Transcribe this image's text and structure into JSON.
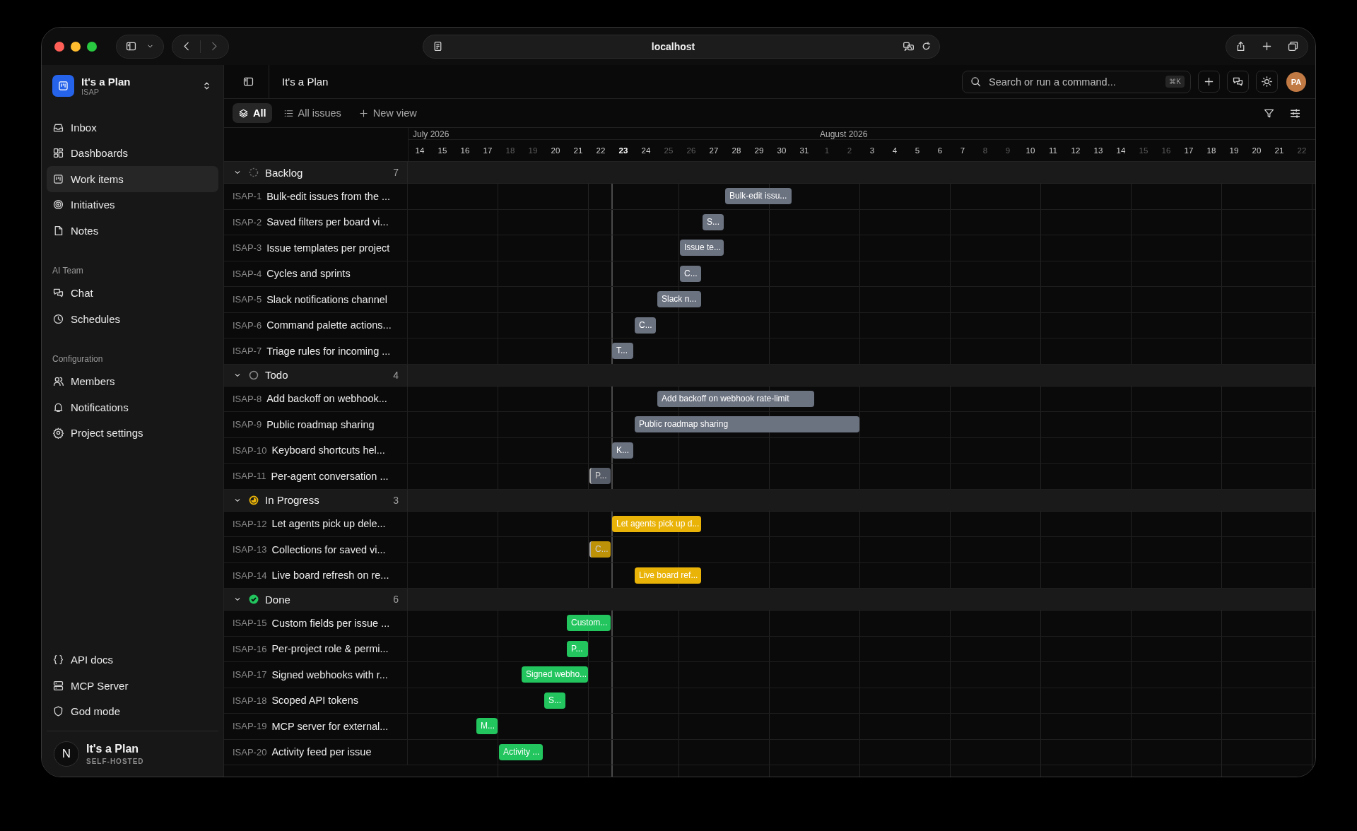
{
  "browser": {
    "url": "localhost"
  },
  "workspace": {
    "name": "It's a Plan",
    "key": "ISAP"
  },
  "nav": [
    {
      "label": "Inbox",
      "selected": false
    },
    {
      "label": "Dashboards",
      "selected": false
    },
    {
      "label": "Work items",
      "selected": true
    },
    {
      "label": "Initiatives",
      "selected": false
    },
    {
      "label": "Notes",
      "selected": false
    }
  ],
  "sections": [
    {
      "title": "AI Team",
      "items": [
        {
          "label": "Chat",
          "selected": false
        },
        {
          "label": "Schedules",
          "selected": false
        }
      ]
    },
    {
      "title": "Configuration",
      "items": [
        {
          "label": "Members",
          "selected": false
        },
        {
          "label": "Notifications",
          "selected": false
        },
        {
          "label": "Project settings",
          "selected": false
        }
      ]
    }
  ],
  "footer_links": [
    {
      "label": "API docs"
    },
    {
      "label": "MCP Server"
    },
    {
      "label": "God mode"
    }
  ],
  "footer": {
    "initial": "N",
    "name": "It's a Plan",
    "edition": "SELF-HOSTED"
  },
  "header": {
    "title": "It's a Plan",
    "search_placeholder": "Search or run a command...",
    "shortcut": "⌘K",
    "avatar": "PA"
  },
  "views": [
    {
      "label": "All",
      "selected": true
    },
    {
      "label": "All issues",
      "selected": false
    },
    {
      "label": "New view",
      "selected": false
    }
  ],
  "timeline": {
    "months": [
      {
        "label": "July 2026",
        "days": [
          {
            "label": "14",
            "weekend": false,
            "today": false
          },
          {
            "label": "15",
            "weekend": false,
            "today": false
          },
          {
            "label": "16",
            "weekend": false,
            "today": false
          },
          {
            "label": "17",
            "weekend": false,
            "today": false
          },
          {
            "label": "18",
            "weekend": true,
            "today": false
          },
          {
            "label": "19",
            "weekend": true,
            "today": false
          },
          {
            "label": "20",
            "weekend": false,
            "today": false
          },
          {
            "label": "21",
            "weekend": false,
            "today": false
          },
          {
            "label": "22",
            "weekend": false,
            "today": false
          },
          {
            "label": "23",
            "weekend": false,
            "today": true
          },
          {
            "label": "24",
            "weekend": false,
            "today": false
          },
          {
            "label": "25",
            "weekend": true,
            "today": false
          },
          {
            "label": "26",
            "weekend": true,
            "today": false
          },
          {
            "label": "27",
            "weekend": false,
            "today": false
          },
          {
            "label": "28",
            "weekend": false,
            "today": false
          },
          {
            "label": "29",
            "weekend": false,
            "today": false
          },
          {
            "label": "30",
            "weekend": false,
            "today": false
          },
          {
            "label": "31",
            "weekend": false,
            "today": false
          }
        ]
      },
      {
        "label": "August 2026",
        "days": [
          {
            "label": "1",
            "weekend": true,
            "today": false
          },
          {
            "label": "2",
            "weekend": true,
            "today": false
          },
          {
            "label": "3",
            "weekend": false,
            "today": false
          },
          {
            "label": "4",
            "weekend": false,
            "today": false
          },
          {
            "label": "5",
            "weekend": false,
            "today": false
          },
          {
            "label": "6",
            "weekend": false,
            "today": false
          },
          {
            "label": "7",
            "weekend": false,
            "today": false
          },
          {
            "label": "8",
            "weekend": true,
            "today": false
          },
          {
            "label": "9",
            "weekend": true,
            "today": false
          },
          {
            "label": "10",
            "weekend": false,
            "today": false
          },
          {
            "label": "11",
            "weekend": false,
            "today": false
          },
          {
            "label": "12",
            "weekend": false,
            "today": false
          },
          {
            "label": "13",
            "weekend": false,
            "today": false
          },
          {
            "label": "14",
            "weekend": false,
            "today": false
          },
          {
            "label": "15",
            "weekend": true,
            "today": false
          },
          {
            "label": "16",
            "weekend": true,
            "today": false
          },
          {
            "label": "17",
            "weekend": false,
            "today": false
          },
          {
            "label": "18",
            "weekend": false,
            "today": false
          },
          {
            "label": "19",
            "weekend": false,
            "today": false
          },
          {
            "label": "20",
            "weekend": false,
            "today": false
          },
          {
            "label": "21",
            "weekend": false,
            "today": false
          },
          {
            "label": "22",
            "weekend": true,
            "today": false
          }
        ]
      }
    ]
  },
  "groups": [
    {
      "name": "Backlog",
      "kind": "backlog",
      "count": "7",
      "expanded": true,
      "items": [
        {
          "id": "ISAP-1",
          "title": "Bulk-edit issues from the ...",
          "bar": {
            "label": "Bulk-edit issu...",
            "muted": false,
            "days": [
              false,
              false,
              false,
              false,
              false,
              false,
              false,
              false,
              false,
              false,
              false,
              false,
              false,
              false,
              true,
              true,
              true,
              false,
              false,
              false,
              false,
              false,
              false,
              false,
              false,
              false,
              false,
              false,
              false,
              false,
              false,
              false,
              false,
              false,
              false,
              false,
              false,
              false,
              false,
              false
            ]
          }
        },
        {
          "id": "ISAP-2",
          "title": "Saved filters per board vi...",
          "bar": {
            "label": "S...",
            "muted": false,
            "days": [
              false,
              false,
              false,
              false,
              false,
              false,
              false,
              false,
              false,
              false,
              false,
              false,
              false,
              true,
              false,
              false,
              false,
              false,
              false,
              false,
              false,
              false,
              false,
              false,
              false,
              false,
              false,
              false,
              false,
              false,
              false,
              false,
              false,
              false,
              false,
              false,
              false,
              false,
              false,
              false
            ]
          }
        },
        {
          "id": "ISAP-3",
          "title": "Issue templates per project",
          "bar": {
            "label": "Issue te...",
            "muted": false,
            "days": [
              false,
              false,
              false,
              false,
              false,
              false,
              false,
              false,
              false,
              false,
              false,
              false,
              true,
              true,
              false,
              false,
              false,
              false,
              false,
              false,
              false,
              false,
              false,
              false,
              false,
              false,
              false,
              false,
              false,
              false,
              false,
              false,
              false,
              false,
              false,
              false,
              false,
              false,
              false,
              false
            ]
          }
        },
        {
          "id": "ISAP-4",
          "title": "Cycles and sprints",
          "bar": {
            "label": "C...",
            "muted": false,
            "days": [
              false,
              false,
              false,
              false,
              false,
              false,
              false,
              false,
              false,
              false,
              false,
              false,
              true,
              false,
              false,
              false,
              false,
              false,
              false,
              false,
              false,
              false,
              false,
              false,
              false,
              false,
              false,
              false,
              false,
              false,
              false,
              false,
              false,
              false,
              false,
              false,
              false,
              false,
              false,
              false
            ]
          }
        },
        {
          "id": "ISAP-5",
          "title": "Slack notifications channel",
          "bar": {
            "label": "Slack n...",
            "muted": false,
            "days": [
              false,
              false,
              false,
              false,
              false,
              false,
              false,
              false,
              false,
              false,
              false,
              true,
              true,
              false,
              false,
              false,
              false,
              false,
              false,
              false,
              false,
              false,
              false,
              false,
              false,
              false,
              false,
              false,
              false,
              false,
              false,
              false,
              false,
              false,
              false,
              false,
              false,
              false,
              false,
              false
            ]
          }
        },
        {
          "id": "ISAP-6",
          "title": "Command palette actions...",
          "bar": {
            "label": "C...",
            "muted": false,
            "days": [
              false,
              false,
              false,
              false,
              false,
              false,
              false,
              false,
              false,
              false,
              true,
              false,
              false,
              false,
              false,
              false,
              false,
              false,
              false,
              false,
              false,
              false,
              false,
              false,
              false,
              false,
              false,
              false,
              false,
              false,
              false,
              false,
              false,
              false,
              false,
              false,
              false,
              false,
              false,
              false
            ]
          }
        },
        {
          "id": "ISAP-7",
          "title": "Triage rules for incoming ...",
          "bar": {
            "label": "T...",
            "muted": false,
            "days": [
              false,
              false,
              false,
              false,
              false,
              false,
              false,
              false,
              false,
              true,
              false,
              false,
              false,
              false,
              false,
              false,
              false,
              false,
              false,
              false,
              false,
              false,
              false,
              false,
              false,
              false,
              false,
              false,
              false,
              false,
              false,
              false,
              false,
              false,
              false,
              false,
              false,
              false,
              false,
              false
            ]
          }
        }
      ]
    },
    {
      "name": "Todo",
      "kind": "todo",
      "count": "4",
      "expanded": true,
      "items": [
        {
          "id": "ISAP-8",
          "title": "Add backoff on webhook...",
          "bar": {
            "label": "Add backoff on webhook rate-limit",
            "muted": false,
            "days": [
              false,
              false,
              false,
              false,
              false,
              false,
              false,
              false,
              false,
              false,
              false,
              true,
              true,
              true,
              true,
              true,
              true,
              true,
              false,
              false,
              false,
              false,
              false,
              false,
              false,
              false,
              false,
              false,
              false,
              false,
              false,
              false,
              false,
              false,
              false,
              false,
              false,
              false,
              false,
              false
            ]
          }
        },
        {
          "id": "ISAP-9",
          "title": "Public roadmap sharing",
          "bar": {
            "label": "Public roadmap sharing",
            "muted": false,
            "days": [
              false,
              false,
              false,
              false,
              false,
              false,
              false,
              false,
              false,
              false,
              true,
              true,
              true,
              true,
              true,
              true,
              true,
              true,
              true,
              true,
              false,
              false,
              false,
              false,
              false,
              false,
              false,
              false,
              false,
              false,
              false,
              false,
              false,
              false,
              false,
              false,
              false,
              false,
              false,
              false
            ]
          }
        },
        {
          "id": "ISAP-10",
          "title": "Keyboard shortcuts hel...",
          "bar": {
            "label": "K...",
            "muted": false,
            "days": [
              false,
              false,
              false,
              false,
              false,
              false,
              false,
              false,
              false,
              true,
              false,
              false,
              false,
              false,
              false,
              false,
              false,
              false,
              false,
              false,
              false,
              false,
              false,
              false,
              false,
              false,
              false,
              false,
              false,
              false,
              false,
              false,
              false,
              false,
              false,
              false,
              false,
              false,
              false,
              false
            ]
          }
        },
        {
          "id": "ISAP-11",
          "title": "Per-agent conversation ...",
          "bar": {
            "label": "P...",
            "muted": true,
            "days": [
              false,
              false,
              false,
              false,
              false,
              false,
              false,
              false,
              true,
              false,
              false,
              false,
              false,
              false,
              false,
              false,
              false,
              false,
              false,
              false,
              false,
              false,
              false,
              false,
              false,
              false,
              false,
              false,
              false,
              false,
              false,
              false,
              false,
              false,
              false,
              false,
              false,
              false,
              false,
              false
            ]
          }
        }
      ]
    },
    {
      "name": "In Progress",
      "kind": "in_progress",
      "count": "3",
      "expanded": true,
      "items": [
        {
          "id": "ISAP-12",
          "title": "Let agents pick up dele...",
          "bar": {
            "label": "Let agents pick up d...",
            "muted": false,
            "days": [
              false,
              false,
              false,
              false,
              false,
              false,
              false,
              false,
              false,
              true,
              true,
              true,
              true,
              false,
              false,
              false,
              false,
              false,
              false,
              false,
              false,
              false,
              false,
              false,
              false,
              false,
              false,
              false,
              false,
              false,
              false,
              false,
              false,
              false,
              false,
              false,
              false,
              false,
              false,
              false
            ]
          }
        },
        {
          "id": "ISAP-13",
          "title": "Collections for saved vi...",
          "bar": {
            "label": "C...",
            "muted": true,
            "days": [
              false,
              false,
              false,
              false,
              false,
              false,
              false,
              false,
              true,
              false,
              false,
              false,
              false,
              false,
              false,
              false,
              false,
              false,
              false,
              false,
              false,
              false,
              false,
              false,
              false,
              false,
              false,
              false,
              false,
              false,
              false,
              false,
              false,
              false,
              false,
              false,
              false,
              false,
              false,
              false
            ]
          }
        },
        {
          "id": "ISAP-14",
          "title": "Live board refresh on re...",
          "bar": {
            "label": "Live board ref...",
            "muted": false,
            "days": [
              false,
              false,
              false,
              false,
              false,
              false,
              false,
              false,
              false,
              false,
              true,
              true,
              true,
              false,
              false,
              false,
              false,
              false,
              false,
              false,
              false,
              false,
              false,
              false,
              false,
              false,
              false,
              false,
              false,
              false,
              false,
              false,
              false,
              false,
              false,
              false,
              false,
              false,
              false,
              false
            ]
          }
        }
      ]
    },
    {
      "name": "Done",
      "kind": "done",
      "count": "6",
      "expanded": true,
      "items": [
        {
          "id": "ISAP-15",
          "title": "Custom fields per issue ...",
          "bar": {
            "label": "Custom...",
            "muted": false,
            "days": [
              false,
              false,
              false,
              false,
              false,
              false,
              false,
              true,
              true,
              false,
              false,
              false,
              false,
              false,
              false,
              false,
              false,
              false,
              false,
              false,
              false,
              false,
              false,
              false,
              false,
              false,
              false,
              false,
              false,
              false,
              false,
              false,
              false,
              false,
              false,
              false,
              false,
              false,
              false,
              false
            ]
          }
        },
        {
          "id": "ISAP-16",
          "title": "Per-project role & permi...",
          "bar": {
            "label": "P...",
            "muted": false,
            "days": [
              false,
              false,
              false,
              false,
              false,
              false,
              false,
              true,
              false,
              false,
              false,
              false,
              false,
              false,
              false,
              false,
              false,
              false,
              false,
              false,
              false,
              false,
              false,
              false,
              false,
              false,
              false,
              false,
              false,
              false,
              false,
              false,
              false,
              false,
              false,
              false,
              false,
              false,
              false,
              false
            ]
          }
        },
        {
          "id": "ISAP-17",
          "title": "Signed webhooks with r...",
          "bar": {
            "label": "Signed webho...",
            "muted": false,
            "days": [
              false,
              false,
              false,
              false,
              false,
              true,
              true,
              true,
              false,
              false,
              false,
              false,
              false,
              false,
              false,
              false,
              false,
              false,
              false,
              false,
              false,
              false,
              false,
              false,
              false,
              false,
              false,
              false,
              false,
              false,
              false,
              false,
              false,
              false,
              false,
              false,
              false,
              false,
              false,
              false
            ]
          }
        },
        {
          "id": "ISAP-18",
          "title": "Scoped API tokens",
          "bar": {
            "label": "S...",
            "muted": false,
            "days": [
              false,
              false,
              false,
              false,
              false,
              false,
              true,
              false,
              false,
              false,
              false,
              false,
              false,
              false,
              false,
              false,
              false,
              false,
              false,
              false,
              false,
              false,
              false,
              false,
              false,
              false,
              false,
              false,
              false,
              false,
              false,
              false,
              false,
              false,
              false,
              false,
              false,
              false,
              false,
              false
            ]
          }
        },
        {
          "id": "ISAP-19",
          "title": "MCP server for external...",
          "bar": {
            "label": "M...",
            "muted": false,
            "days": [
              false,
              false,
              false,
              true,
              false,
              false,
              false,
              false,
              false,
              false,
              false,
              false,
              false,
              false,
              false,
              false,
              false,
              false,
              false,
              false,
              false,
              false,
              false,
              false,
              false,
              false,
              false,
              false,
              false,
              false,
              false,
              false,
              false,
              false,
              false,
              false,
              false,
              false,
              false,
              false
            ]
          }
        },
        {
          "id": "ISAP-20",
          "title": "Activity feed per issue",
          "bar": {
            "label": "Activity ...",
            "muted": false,
            "days": [
              false,
              false,
              false,
              false,
              true,
              true,
              false,
              false,
              false,
              false,
              false,
              false,
              false,
              false,
              false,
              false,
              false,
              false,
              false,
              false,
              false,
              false,
              false,
              false,
              false,
              false,
              false,
              false,
              false,
              false,
              false,
              false,
              false,
              false,
              false,
              false,
              false,
              false,
              false,
              false
            ]
          }
        }
      ]
    }
  ]
}
